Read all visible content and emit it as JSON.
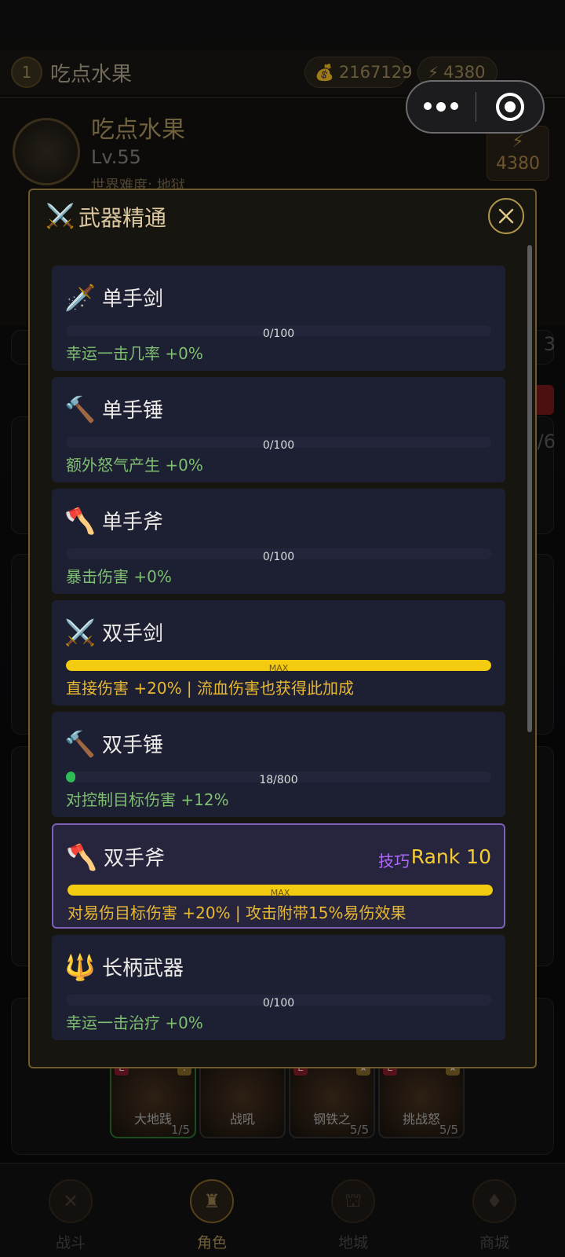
{
  "header": {
    "level": "1",
    "player_name": "吃点水果",
    "gold": "2167129",
    "energy": "4380"
  },
  "hero": {
    "name": "吃点水果",
    "level": "Lv.55",
    "difficulty": "世界难度: 地狱",
    "energy": "4380"
  },
  "background": {
    "right_num_1": "3",
    "right_num_2": "6/6"
  },
  "skills": [
    {
      "tag": "E",
      "corner": "!",
      "name": "大地践",
      "count": "1/5"
    },
    {
      "tag": "",
      "corner": "",
      "name": "战吼",
      "count": ""
    },
    {
      "tag": "E",
      "corner": "★",
      "name": "钢铁之",
      "count": "5/5"
    },
    {
      "tag": "E",
      "corner": "★",
      "name": "挑战怒",
      "count": "5/5"
    }
  ],
  "nav": [
    {
      "label": "战斗",
      "icon": "swords-icon"
    },
    {
      "label": "角色",
      "icon": "helmet-icon"
    },
    {
      "label": "地城",
      "icon": "gate-icon"
    },
    {
      "label": "商城",
      "icon": "shop-icon"
    }
  ],
  "modal": {
    "title": "武器精通",
    "title_icon": "⚔️",
    "items": [
      {
        "icon": "🗡️",
        "icon_name": "dagger-icon",
        "name": "单手剑",
        "progress_text": "0/100",
        "progress": 0,
        "desc": "幸运一击几率 +0%",
        "maxed": false
      },
      {
        "icon": "🔨",
        "icon_name": "hammer-icon",
        "name": "单手锤",
        "progress_text": "0/100",
        "progress": 0,
        "desc": "额外怒气产生 +0%",
        "maxed": false
      },
      {
        "icon": "🪓",
        "icon_name": "axe-icon",
        "name": "单手斧",
        "progress_text": "0/100",
        "progress": 0,
        "desc": "暴击伤害 +0%",
        "maxed": false
      },
      {
        "icon": "⚔️",
        "icon_name": "crossed-swords-icon",
        "name": "双手剑",
        "progress_text": "MAX",
        "progress": 1,
        "desc": "直接伤害 +20% | 流血伤害也获得此加成",
        "maxed": true
      },
      {
        "icon": "🔨",
        "icon_name": "hammer-icon",
        "name": "双手锤",
        "progress_text": "18/800",
        "progress": 0.0225,
        "desc": "对控制目标伤害 +12%",
        "maxed": false
      },
      {
        "icon": "🪓",
        "icon_name": "axe-icon",
        "name": "双手斧",
        "sub": "技巧",
        "rank": "Rank 10",
        "progress_text": "MAX",
        "progress": 1,
        "desc": "对易伤目标伤害 +20% | 攻击附带15%易伤效果",
        "maxed": true
      },
      {
        "icon": "🔱",
        "icon_name": "polearm-icon",
        "name": "长柄武器",
        "progress_text": "0/100",
        "progress": 0,
        "desc": "幸运一击治疗 +0%",
        "maxed": false
      }
    ]
  }
}
